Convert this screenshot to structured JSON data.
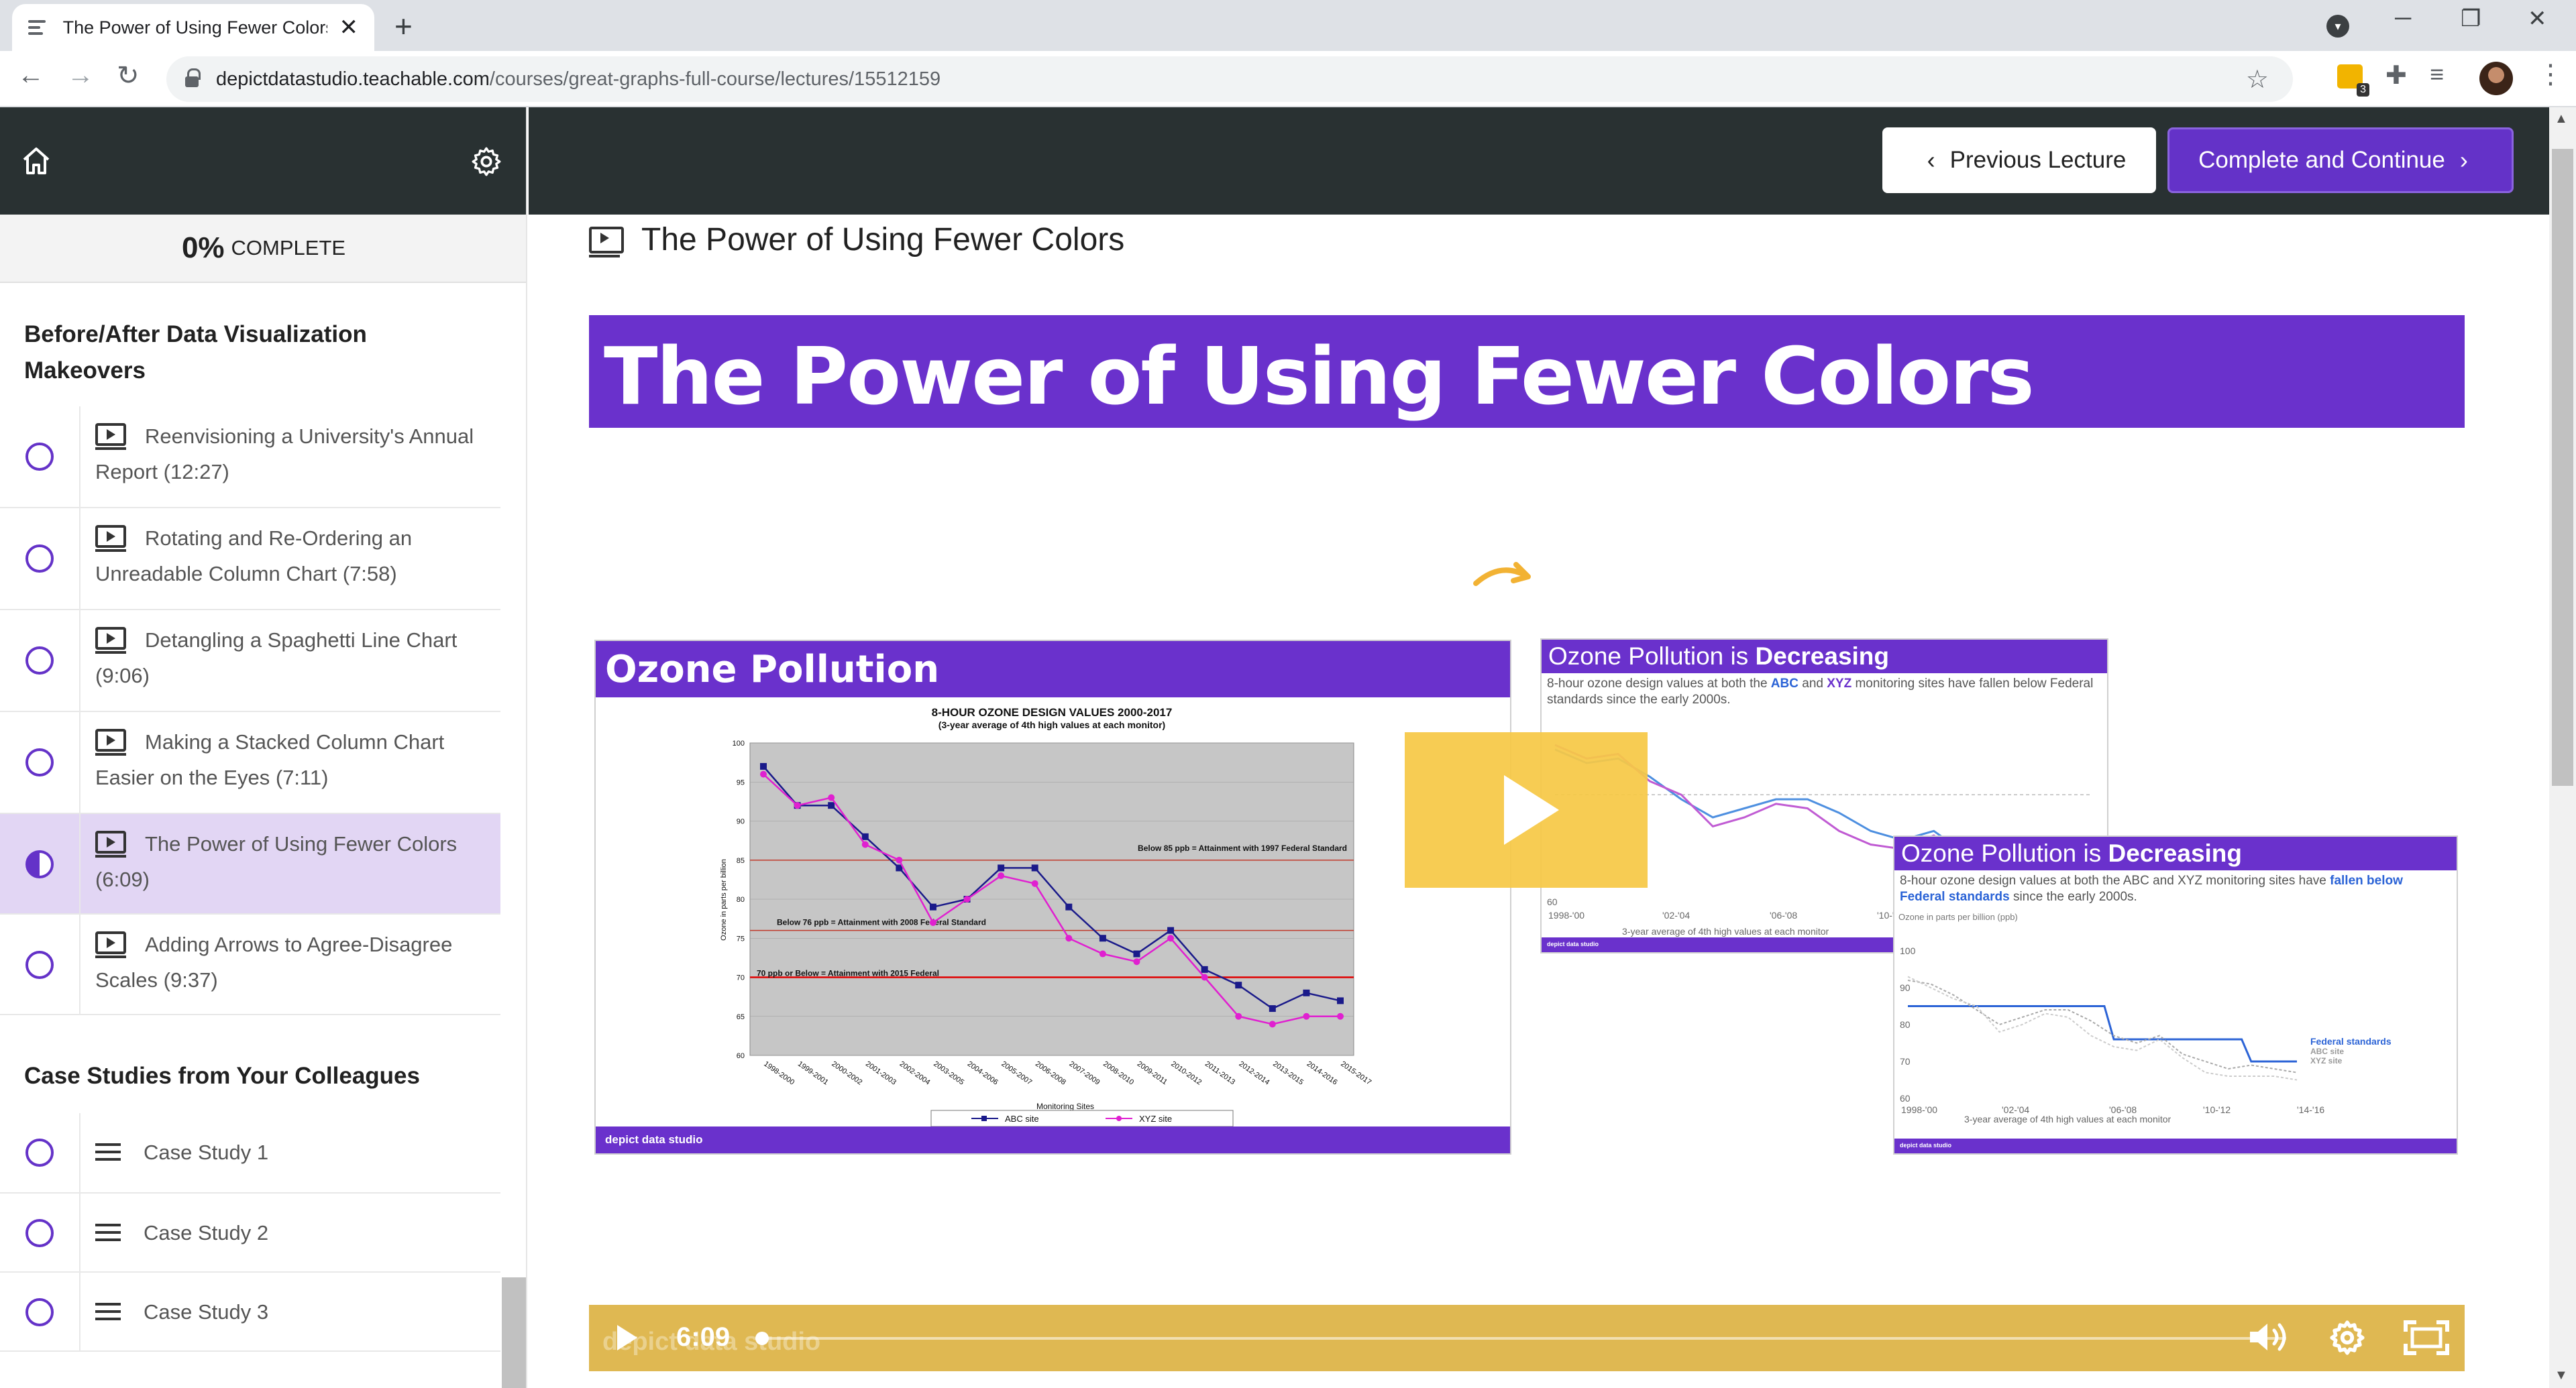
{
  "browser": {
    "tab_title": "The Power of Using Fewer Colors",
    "tab_close": "✕",
    "new_tab": "+",
    "url_host": "depictdatastudio.teachable.com",
    "url_path": "/courses/great-graphs-full-course/lectures/15512159",
    "ext_badge": "3"
  },
  "sidebar": {
    "progress_value": "0%",
    "progress_label": "COMPLETE",
    "sections": [
      {
        "title": "Before/After Data Visualization Makeovers",
        "lectures": [
          {
            "label": "Reenvisioning a University's Annual Report (12:27)",
            "type": "video",
            "state": "incomplete"
          },
          {
            "label": "Rotating and Re-Ordering an Unreadable Column Chart (7:58)",
            "type": "video",
            "state": "incomplete"
          },
          {
            "label": "Detangling a Spaghetti Line Chart (9:06)",
            "type": "video",
            "state": "incomplete"
          },
          {
            "label": "Making a Stacked Column Chart Easier on the Eyes (7:11)",
            "type": "video",
            "state": "incomplete"
          },
          {
            "label": "The Power of Using Fewer Colors (6:09)",
            "type": "video",
            "state": "in-progress"
          },
          {
            "label": "Adding Arrows to Agree-Disagree Scales (9:37)",
            "type": "video",
            "state": "incomplete"
          }
        ]
      },
      {
        "title": "Case Studies from Your Colleagues",
        "lectures": [
          {
            "label": "Case Study 1",
            "type": "text",
            "state": "incomplete"
          },
          {
            "label": "Case Study 2",
            "type": "text",
            "state": "incomplete"
          },
          {
            "label": "Case Study 3",
            "type": "text",
            "state": "incomplete"
          }
        ]
      }
    ]
  },
  "header": {
    "prev_label": "Previous Lecture",
    "next_label": "Complete and Continue"
  },
  "lecture": {
    "title": "The Power of Using Fewer Colors"
  },
  "video": {
    "banner_title": "The Power of Using Fewer Colors",
    "duration": "6:09",
    "watermark": "depict data studio",
    "old_slide": {
      "title": "Ozone Pollution",
      "chart_title": "8-HOUR OZONE DESIGN VALUES 2000-2017",
      "chart_subtitle": "(3-year average of 4th high values at each monitor)",
      "ylabel": "Ozone in parts per billion",
      "xlabel": "Monitoring Sites",
      "ref1": "Below 85 ppb = Attainment with 1997 Federal Standard",
      "ref2": "Below 76 ppb = Attainment with 2008 Federal Standard",
      "ref3": "70 ppb or Below = Attainment with 2015 Federal",
      "legend_abc": "ABC site",
      "legend_xyz": "XYZ site",
      "footer": "depict data studio"
    },
    "new_slide_a": {
      "title_pre": "Ozone Pollution is ",
      "title_bold": "Decreasing",
      "sub_1": "8-hour ozone design values at both the ",
      "sub_abc": "ABC",
      "sub_and": " and ",
      "sub_xyz": "XYZ",
      "sub_2": " monitoring sites have fallen below Federal standards since the early 2000s.",
      "xcap": "3-year average of 4th high values at each monitor",
      "footer": "depict data studio"
    },
    "new_slide_b": {
      "title_pre": "Ozone Pollution is ",
      "title_bold": "Decreasing",
      "sub_1": "8-hour ozone design values at both the ABC and XYZ monitoring sites have ",
      "sub_emph": "fallen below Federal standards",
      "sub_2": " since the early 2000s.",
      "ylabel": "Ozone in parts per billion (ppb)",
      "legend_fed": "Federal standards",
      "legend_abc": "ABC site",
      "legend_xyz": "XYZ site",
      "xcap": "3-year average of 4th high values at each monitor",
      "footer": "depict data studio"
    }
  },
  "chart_data": [
    {
      "type": "line",
      "title": "8-HOUR OZONE DESIGN VALUES 2000-2017",
      "subtitle": "(3-year average of 4th high values at each monitor)",
      "xlabel": "Monitoring Sites",
      "ylabel": "Ozone in parts per billion",
      "ylim": [
        60,
        100
      ],
      "categories": [
        "1998-2000",
        "1999-2001",
        "2000-2002",
        "2001-2003",
        "2002-2004",
        "2003-2005",
        "2004-2006",
        "2005-2007",
        "2006-2008",
        "2007-2009",
        "2008-2010",
        "2009-2011",
        "2010-2012",
        "2011-2013",
        "2012-2014",
        "2013-2015",
        "2014-2016",
        "2015-2017"
      ],
      "y_ticks": [
        60,
        65,
        70,
        75,
        80,
        85,
        90,
        95,
        100
      ],
      "series": [
        {
          "name": "ABC site",
          "color": "#1a1a8a",
          "values": [
            97,
            92,
            92,
            88,
            84,
            79,
            80,
            84,
            84,
            79,
            75,
            73,
            76,
            71,
            69,
            66,
            68,
            67
          ]
        },
        {
          "name": "XYZ site",
          "color": "#e020d0",
          "values": [
            96,
            92,
            93,
            87,
            85,
            77,
            80,
            83,
            82,
            75,
            73,
            72,
            75,
            70,
            65,
            64,
            65,
            65
          ]
        }
      ],
      "reference_lines": [
        {
          "label": "Below 85 ppb = Attainment with 1997 Federal Standard",
          "value": 85
        },
        {
          "label": "Below 76 ppb = Attainment with 2008 Federal Standard",
          "value": 76
        },
        {
          "label": "70 ppb or Below = Attainment with 2015 Federal",
          "value": 70
        }
      ],
      "grid": true,
      "legend": "bottom"
    },
    {
      "type": "line",
      "title": "Ozone Pollution is Decreasing",
      "xlabel": "3-year average of 4th high values at each monitor",
      "ylim": [
        60,
        100
      ],
      "y_ticks": [
        60
      ],
      "categories": [
        "1998-'00",
        "'02-'04",
        "'06-'08",
        "'10-'12"
      ],
      "series": [
        {
          "name": "ABC site",
          "color": "#4d8fe0",
          "values": [
            95,
            92,
            93,
            89,
            84,
            80,
            82,
            84,
            84,
            81,
            77,
            75,
            77,
            72,
            70,
            68,
            69,
            68
          ]
        },
        {
          "name": "XYZ site",
          "color": "#c05bd3",
          "values": [
            96,
            93,
            94,
            88,
            85,
            78,
            80,
            83,
            82,
            77,
            74,
            73,
            76,
            71,
            67,
            66,
            66,
            66
          ]
        }
      ]
    },
    {
      "type": "line",
      "title": "Ozone Pollution is Decreasing",
      "ylabel": "Ozone in parts per billion (ppb)",
      "xlabel": "3-year average of 4th high values at each monitor",
      "ylim": [
        60,
        100
      ],
      "y_ticks": [
        60,
        70,
        80,
        90,
        100
      ],
      "categories": [
        "1998-'00",
        "'02-'04",
        "'06-'08",
        "'10-'12",
        "'14-'16"
      ],
      "series": [
        {
          "name": "Federal standards",
          "color": "#2b63d6",
          "values": [
            85,
            85,
            85,
            85,
            85,
            85,
            85,
            85,
            85,
            76,
            76,
            76,
            76,
            76,
            76,
            70,
            70,
            70
          ]
        },
        {
          "name": "ABC site",
          "color": "#aaaaaa",
          "values": [
            92,
            91,
            88,
            84,
            80,
            82,
            84,
            84,
            81,
            77,
            75,
            77,
            72,
            70,
            68,
            69,
            68,
            67
          ]
        },
        {
          "name": "XYZ site",
          "color": "#cccccc",
          "values": [
            93,
            90,
            87,
            85,
            78,
            80,
            83,
            82,
            77,
            74,
            73,
            76,
            71,
            67,
            66,
            66,
            66,
            65
          ]
        }
      ],
      "legend": "right"
    }
  ]
}
